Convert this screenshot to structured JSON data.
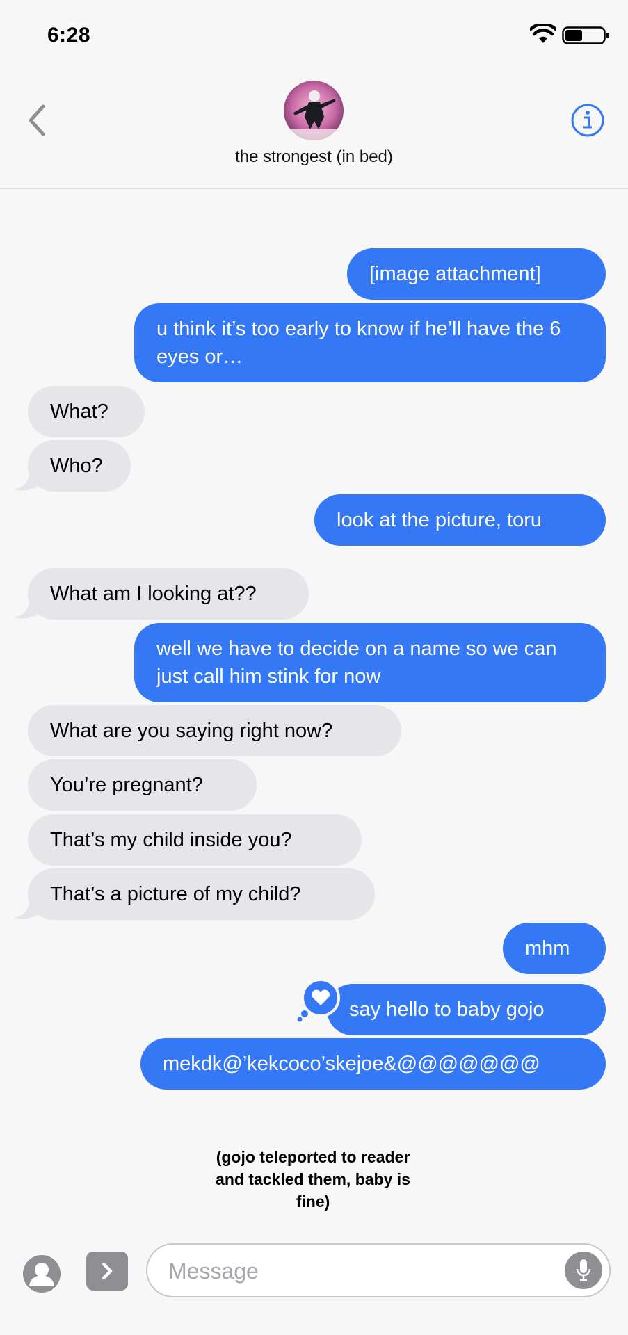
{
  "status_bar": {
    "time": "6:28"
  },
  "header": {
    "contact_name": "the strongest (in bed)",
    "back_icon": "chevron-left-icon",
    "info_icon": "info-icon"
  },
  "messages": [
    {
      "side": "sent",
      "text": "[image attachment]"
    },
    {
      "side": "sent",
      "text": "u think it’s too early to know if he’ll have the 6 eyes or…"
    },
    {
      "side": "received",
      "text": "What?"
    },
    {
      "side": "received",
      "text": "Who?"
    },
    {
      "side": "sent",
      "text": "look at the picture, toru"
    },
    {
      "side": "received",
      "text": "What am I looking at??"
    },
    {
      "side": "sent",
      "text": "well we have to decide on a name so we can just call him stink for now"
    },
    {
      "side": "received",
      "text": "What are you saying right now?"
    },
    {
      "side": "received",
      "text": "You’re pregnant?"
    },
    {
      "side": "received",
      "text": "That’s my child inside you?"
    },
    {
      "side": "received",
      "text": "That’s a picture of my child?"
    },
    {
      "side": "sent",
      "text": "mhm"
    },
    {
      "side": "sent",
      "text": "say hello to baby gojo",
      "tapback": "heart-icon"
    },
    {
      "side": "sent",
      "text": "mekdk@’kekcoco’skejoe&@@@@@@@"
    }
  ],
  "caption": "(gojo teleported to reader and tackled them, baby is fine)",
  "composer": {
    "placeholder": "Message"
  },
  "colors": {
    "sent_bubble": "#3478f6",
    "received_bubble": "#e5e5ea",
    "accent": "#3478f6"
  }
}
